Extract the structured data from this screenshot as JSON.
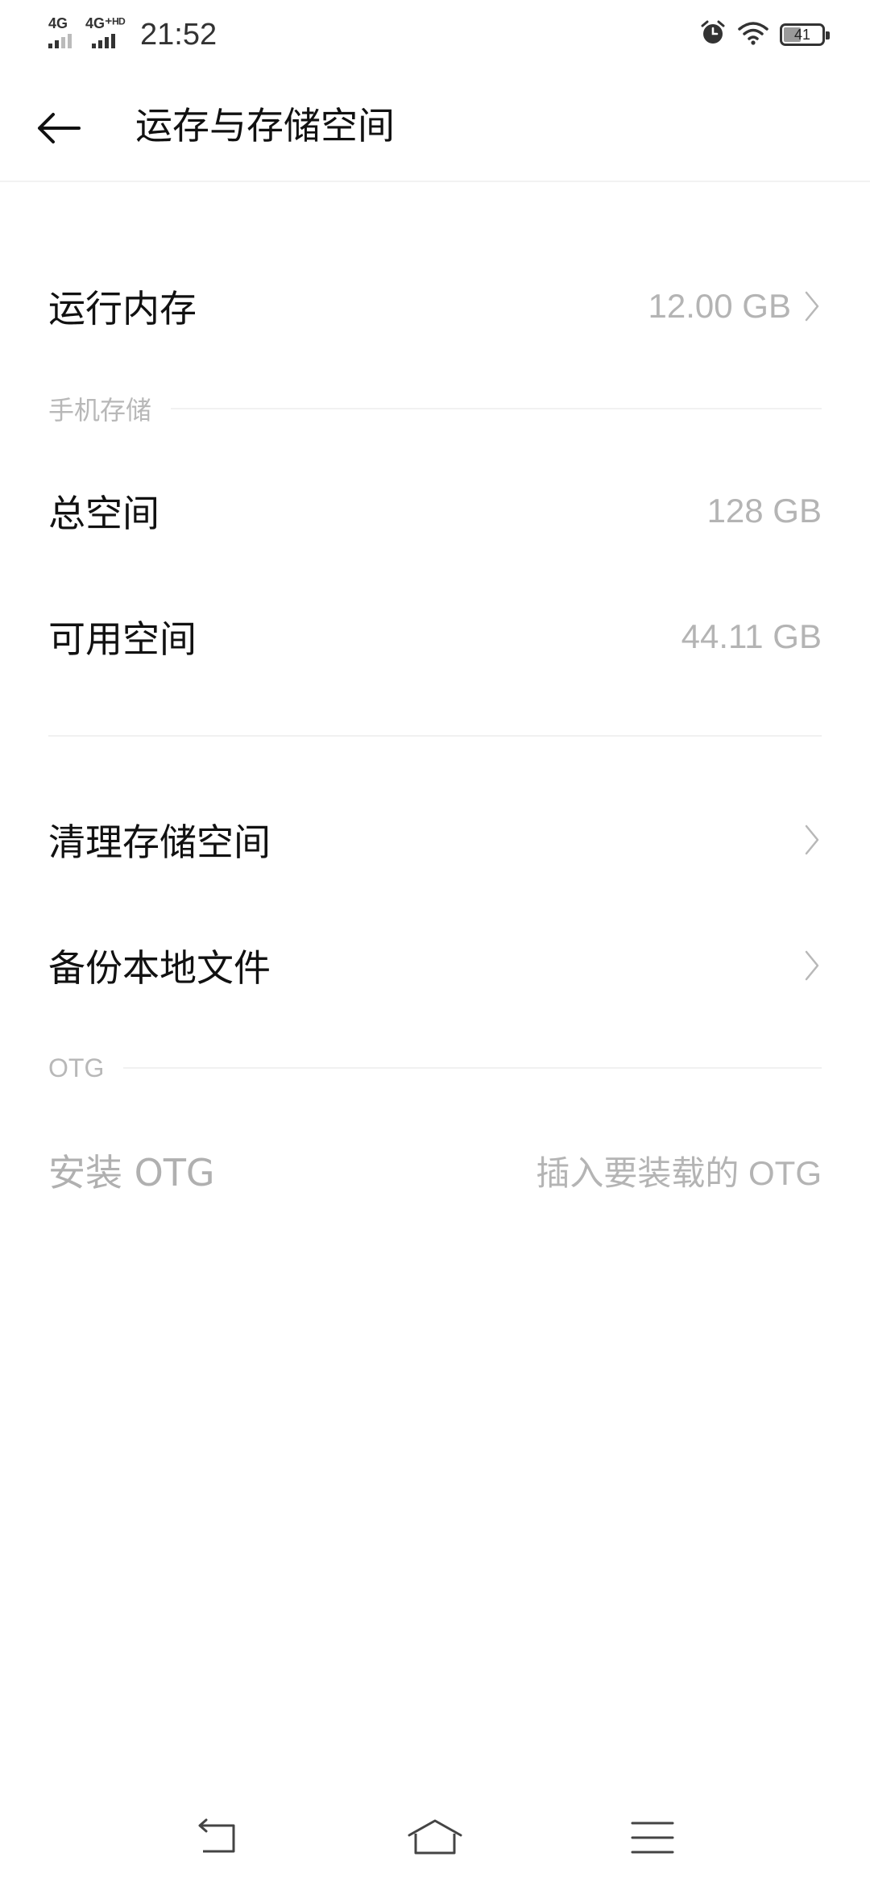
{
  "status_bar": {
    "time": "21:52",
    "signal_1_label": "4G",
    "signal_2_label": "4G⁺ᴴᴰ",
    "battery_level": "41",
    "icons": [
      "signal-4g-icon",
      "signal-4g-hd-icon",
      "alarm-icon",
      "wifi-icon",
      "battery-icon"
    ]
  },
  "header": {
    "title": "运存与存储空间",
    "back_icon": "back-arrow-icon"
  },
  "ram": {
    "label": "运行内存",
    "value": "12.00 GB"
  },
  "phone_storage": {
    "section_label": "手机存储",
    "total": {
      "label": "总空间",
      "value": "128 GB"
    },
    "available": {
      "label": "可用空间",
      "value": "44.11 GB"
    }
  },
  "actions": {
    "clean": {
      "label": "清理存储空间"
    },
    "backup": {
      "label": "备份本地文件"
    }
  },
  "otg": {
    "section_label": "OTG",
    "mount": {
      "label": "安装 OTG",
      "value": "插入要装载的 OTG"
    }
  },
  "nav_bar": {
    "icons": [
      "nav-back-icon",
      "nav-home-icon",
      "nav-menu-icon"
    ]
  },
  "colors": {
    "background": "#ffffff",
    "primary_text": "#111111",
    "secondary_text": "#b4b4b4",
    "divider": "#f1f1f1"
  }
}
